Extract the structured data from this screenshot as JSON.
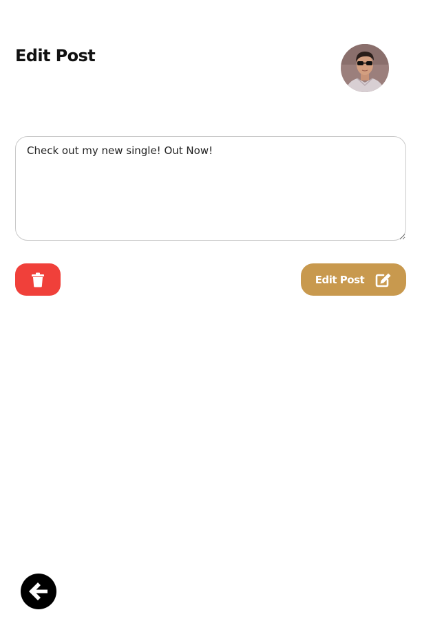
{
  "header": {
    "title": "Edit Post"
  },
  "avatar": {
    "icon": "user-avatar-photo"
  },
  "post_input": {
    "value": "Check out my new single! Out Now!"
  },
  "actions": {
    "delete_icon": "trash-icon",
    "edit_label": "Edit Post",
    "edit_icon": "edit-icon"
  },
  "navigation": {
    "back_icon": "arrow-left-icon"
  },
  "colors": {
    "delete": "#f0403a",
    "edit": "#c8994e",
    "back": "#000000"
  }
}
